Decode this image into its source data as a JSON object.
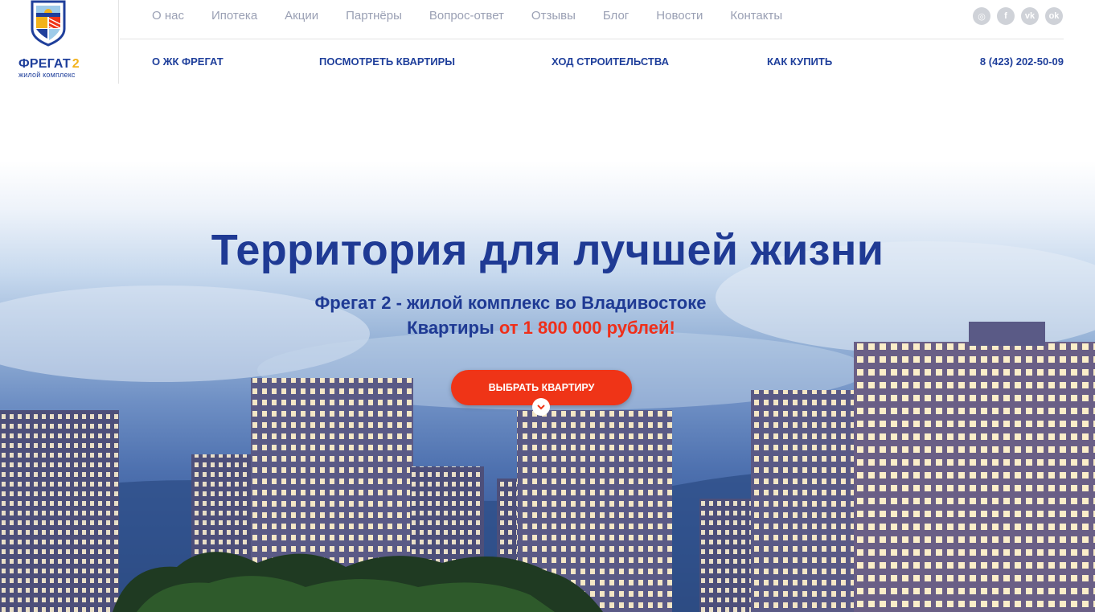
{
  "brand": {
    "name": "ФРЕГАТ",
    "number": "2",
    "subtitle": "жилой комплекс",
    "colors": {
      "navy": "#1f3f9b",
      "yellow": "#f3b21a",
      "red": "#ef3417"
    }
  },
  "topnav": [
    {
      "label": "О нас"
    },
    {
      "label": "Ипотека"
    },
    {
      "label": "Акции"
    },
    {
      "label": "Партнёры"
    },
    {
      "label": "Вопрос-ответ"
    },
    {
      "label": "Отзывы"
    },
    {
      "label": "Блог"
    },
    {
      "label": "Новости"
    },
    {
      "label": "Контакты"
    }
  ],
  "socials": [
    {
      "icon": "instagram-icon",
      "glyph": "◎"
    },
    {
      "icon": "facebook-icon",
      "glyph": "f"
    },
    {
      "icon": "vk-icon",
      "glyph": "vk"
    },
    {
      "icon": "odnoklassniki-icon",
      "glyph": "ok"
    }
  ],
  "mainnav": [
    {
      "label": "О ЖК ФРЕГАТ"
    },
    {
      "label": "ПОСМОТРЕТЬ КВАРТИРЫ"
    },
    {
      "label": "ХОД СТРОИТЕЛЬСТВА"
    },
    {
      "label": "КАК КУПИТЬ"
    }
  ],
  "phone": "8 (423) 202-50-09",
  "hero": {
    "title": "Территория для лучшей жизни",
    "subtitle": "Фрегат 2 - жилой комплекс во Владивостоке",
    "price_prefix": "Квартиры",
    "price_accent": "от 1 800 000 рублей!",
    "cta_label": "ВЫБРАТЬ КВАРТИРУ"
  }
}
